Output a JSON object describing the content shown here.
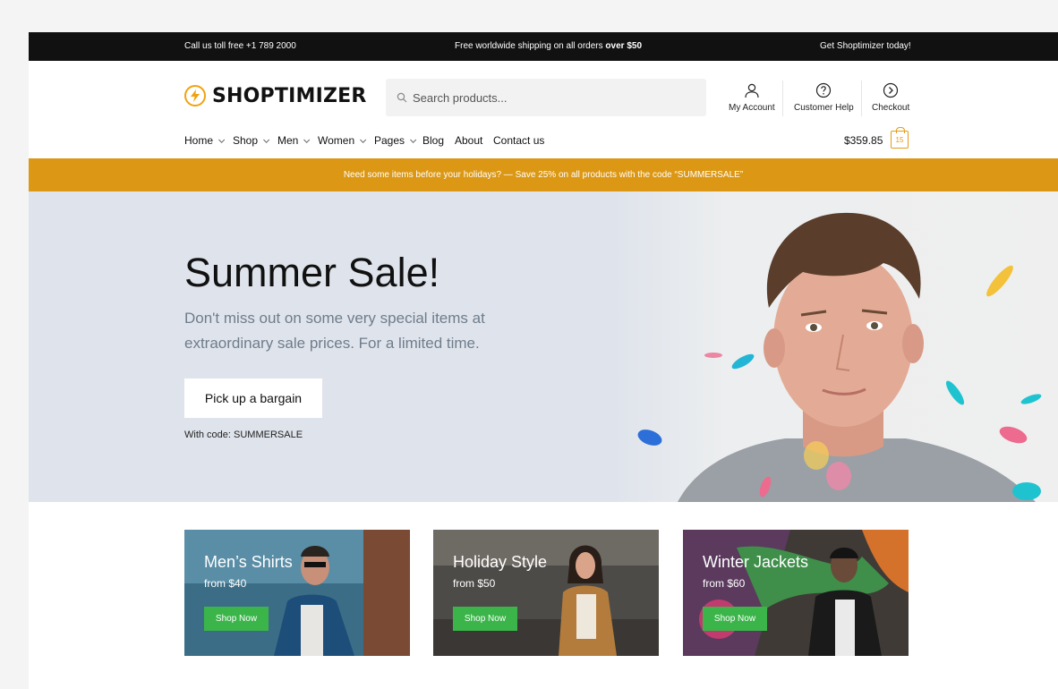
{
  "topbar": {
    "left": "Call us toll free +1 789 2000",
    "mid_prefix": "Free worldwide shipping on all orders ",
    "mid_bold": "over $50",
    "right": "Get Shoptimizer today!"
  },
  "logo": {
    "text": "SHOPTIMIZER"
  },
  "search": {
    "placeholder": "Search products..."
  },
  "header_links": [
    {
      "label": "My Account",
      "icon": "user-icon"
    },
    {
      "label": "Customer Help",
      "icon": "question-circle-icon"
    },
    {
      "label": "Checkout",
      "icon": "arrow-right-circle-icon"
    }
  ],
  "nav": [
    {
      "label": "Home",
      "dropdown": true
    },
    {
      "label": "Shop",
      "dropdown": true
    },
    {
      "label": "Men",
      "dropdown": true
    },
    {
      "label": "Women",
      "dropdown": true
    },
    {
      "label": "Pages",
      "dropdown": true
    },
    {
      "label": "Blog",
      "dropdown": false
    },
    {
      "label": "About",
      "dropdown": false
    },
    {
      "label": "Contact us",
      "dropdown": false
    }
  ],
  "cart": {
    "total": "$359.85",
    "count": "15"
  },
  "promo": {
    "text": "Need some items before your holidays? — Save 25% on all products with the code “SUMMERSALE”"
  },
  "hero": {
    "title": "Summer Sale!",
    "subtitle": "Don't miss out on some very special items at extraordinary sale prices. For a limited time.",
    "button": "Pick up a bargain",
    "code": "With code: SUMMERSALE"
  },
  "cards": [
    {
      "title": "Men’s Shirts",
      "price": "from $40",
      "button": "Shop Now"
    },
    {
      "title": "Holiday Style",
      "price": "from $50",
      "button": "Shop Now"
    },
    {
      "title": "Winter Jackets",
      "price": "from $60",
      "button": "Shop Now"
    }
  ],
  "colors": {
    "accent": "#dc9814",
    "topbar": "#111111",
    "hero_bg": "#dfe4ec",
    "shop_button": "#3bb54a"
  }
}
